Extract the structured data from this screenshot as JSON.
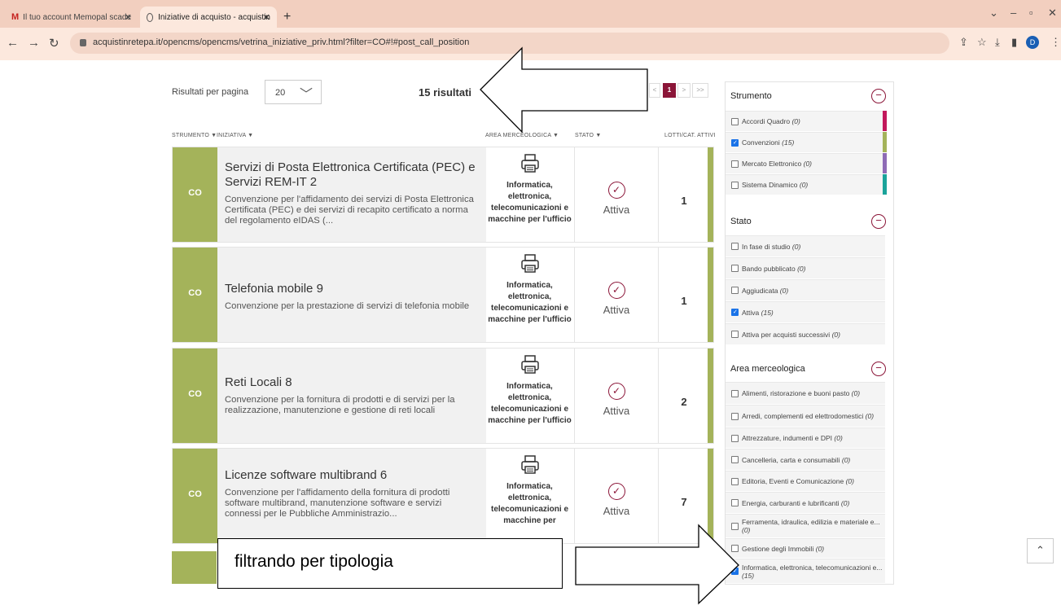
{
  "browser": {
    "tabs": [
      {
        "label": "Il tuo account Memopal scade",
        "icon": "gmail-icon"
      },
      {
        "label": "Iniziative di acquisto - acquistin",
        "icon": "globe-icon"
      }
    ],
    "url": "acquistinretepa.it/opencms/opencms/vetrina_iniziative_priv.html?filter=CO#!#post_call_position",
    "profile_initial": "D"
  },
  "toolbar": {
    "per_page_label": "Risultati per pagina",
    "per_page_value": "20",
    "results": "15 risultati",
    "pagination": {
      "prev": "<",
      "current": "1",
      "next": ">",
      "last": ">>"
    }
  },
  "columns": {
    "strumento": "STRUMENTO ▼",
    "iniziativa": "INIZIATIVA ▼",
    "area": "AREA MERCEOLOGICA ▼",
    "stato": "STATO ▼",
    "lotti": "LOTTI/CAT. ATTIVI"
  },
  "cards": [
    {
      "badge": "CO",
      "title": "Servizi di Posta Elettronica Certificata (PEC) e Servizi REM-IT 2",
      "desc": "Convenzione per l'affidamento dei servizi di Posta Elettronica Certificata (PEC) e dei servizi di recapito certificato a norma del regolamento eIDAS (...",
      "area": "Informatica, elettronica, telecomunicazioni e macchine per l'ufficio",
      "stato": "Attiva",
      "lotti": "1"
    },
    {
      "badge": "CO",
      "title": "Telefonia mobile 9",
      "desc": "Convenzione per la prestazione di servizi di telefonia mobile",
      "area": "Informatica, elettronica, telecomunicazioni e macchine per l'ufficio",
      "stato": "Attiva",
      "lotti": "1"
    },
    {
      "badge": "CO",
      "title": "Reti Locali 8",
      "desc": "Convenzione per la fornitura di prodotti e di servizi per la realizzazione, manutenzione e gestione di reti locali",
      "area": "Informatica, elettronica, telecomunicazioni e macchine per l'ufficio",
      "stato": "Attiva",
      "lotti": "2"
    },
    {
      "badge": "CO",
      "title": "Licenze software multibrand 6",
      "desc": "Convenzione per l'affidamento della fornitura di prodotti software multibrand, manutenzione software e servizi connessi per le Pubbliche Amministrazio...",
      "area": "Informatica, elettronica, telecomunicazioni e macchine per",
      "stato": "Attiva",
      "lotti": "7"
    }
  ],
  "filters": {
    "strumento": {
      "title": "Strumento",
      "items": [
        {
          "label": "Accordi Quadro",
          "count": "(0)",
          "checked": false,
          "color": "#c2185b"
        },
        {
          "label": "Convenzioni",
          "count": "(15)",
          "checked": true,
          "color": "#a4b35a"
        },
        {
          "label": "Mercato Elettronico",
          "count": "(0)",
          "checked": false,
          "color": "#8e6bb5"
        },
        {
          "label": "Sistema Dinamico",
          "count": "(0)",
          "checked": false,
          "color": "#1aa39a"
        }
      ]
    },
    "stato": {
      "title": "Stato",
      "items": [
        {
          "label": "In fase di studio",
          "count": "(0)",
          "checked": false
        },
        {
          "label": "Bando pubblicato",
          "count": "(0)",
          "checked": false
        },
        {
          "label": "Aggiudicata",
          "count": "(0)",
          "checked": false
        },
        {
          "label": "Attiva",
          "count": "(15)",
          "checked": true
        },
        {
          "label": "Attiva per acquisti successivi",
          "count": "(0)",
          "checked": false
        }
      ]
    },
    "area": {
      "title": "Area merceologica",
      "items": [
        {
          "label": "Alimenti, ristorazione e buoni pasto",
          "count": "(0)",
          "checked": false
        },
        {
          "label": "Arredi, complementi ed elettrodomestici",
          "count": "(0)",
          "checked": false
        },
        {
          "label": "Attrezzature, indumenti e DPI",
          "count": "(0)",
          "checked": false
        },
        {
          "label": "Cancelleria, carta e consumabili",
          "count": "(0)",
          "checked": false
        },
        {
          "label": "Editoria, Eventi e Comunicazione",
          "count": "(0)",
          "checked": false
        },
        {
          "label": "Energia, carburanti e lubrificanti",
          "count": "(0)",
          "checked": false
        },
        {
          "label": "Ferramenta, idraulica, edilizia e materiale e...",
          "count": "(0)",
          "checked": false
        },
        {
          "label": "Gestione degli Immobili",
          "count": "(0)",
          "checked": false
        },
        {
          "label": "Informatica, elettronica, telecomunicazioni e...",
          "count": "(15)",
          "checked": true
        }
      ]
    }
  },
  "annotation": {
    "text": "filtrando per tipologia"
  },
  "colors": {
    "accent": "#8b1538",
    "co_green": "#a4b35a"
  }
}
